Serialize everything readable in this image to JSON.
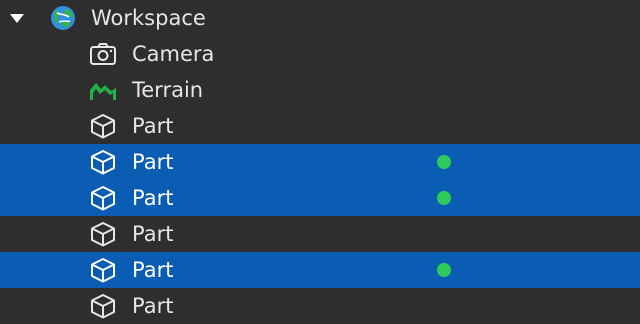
{
  "colors": {
    "background": "#2e2e2e",
    "selection": "#0b5cb3",
    "text": "#e6e6e6",
    "status_dot": "#2ecc5a",
    "terrain": "#22b04b"
  },
  "tree": [
    {
      "label": "Workspace",
      "icon": "workspace-globe-icon",
      "expanded": true,
      "selected": false,
      "status_dot": false
    },
    {
      "label": "Camera",
      "icon": "camera-icon",
      "selected": false,
      "status_dot": false
    },
    {
      "label": "Terrain",
      "icon": "terrain-icon",
      "selected": false,
      "status_dot": false
    },
    {
      "label": "Part",
      "icon": "part-cube-icon",
      "selected": false,
      "status_dot": false
    },
    {
      "label": "Part",
      "icon": "part-cube-icon",
      "selected": true,
      "status_dot": true
    },
    {
      "label": "Part",
      "icon": "part-cube-icon",
      "selected": true,
      "status_dot": true
    },
    {
      "label": "Part",
      "icon": "part-cube-icon",
      "selected": false,
      "status_dot": false
    },
    {
      "label": "Part",
      "icon": "part-cube-icon",
      "selected": true,
      "status_dot": true
    },
    {
      "label": "Part",
      "icon": "part-cube-icon",
      "selected": false,
      "status_dot": false
    }
  ]
}
